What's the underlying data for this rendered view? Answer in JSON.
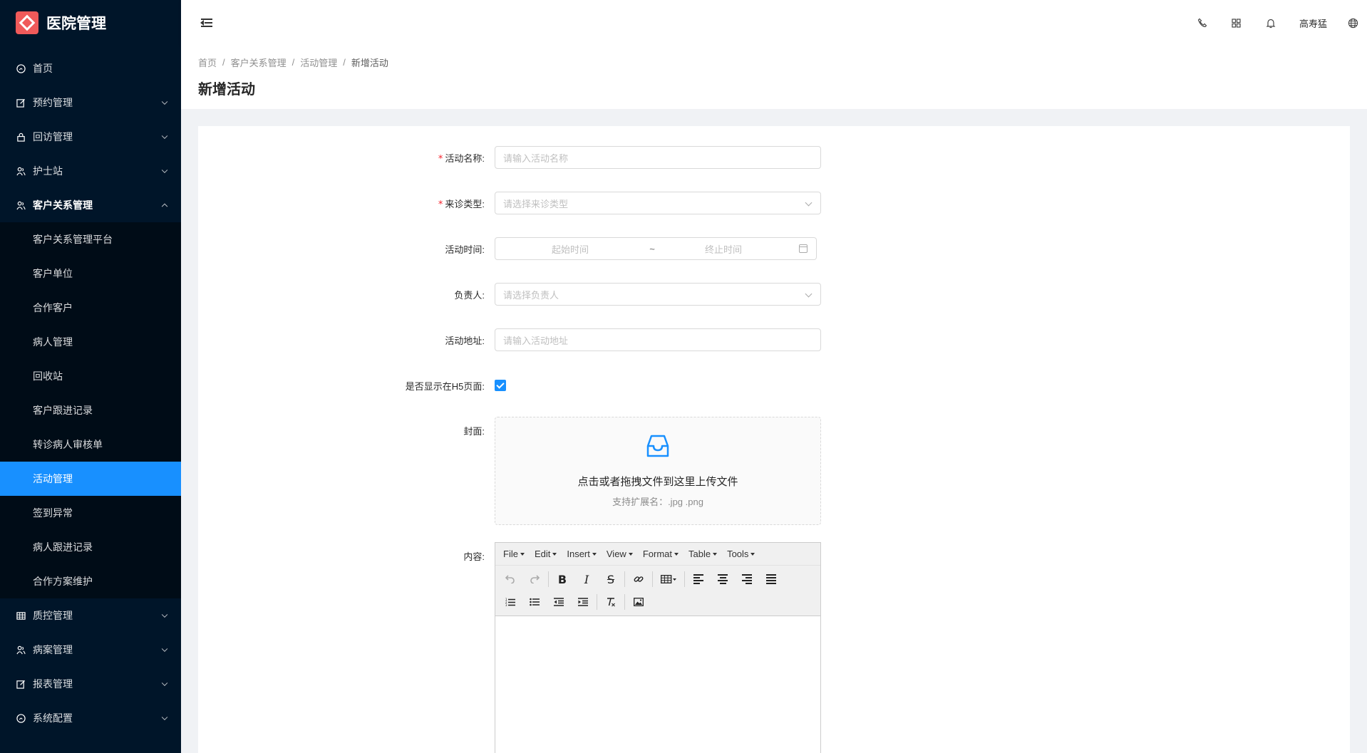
{
  "app": {
    "title": "医院管理"
  },
  "sidebar": {
    "items": [
      {
        "label": "首页",
        "icon": "dashboard-icon"
      },
      {
        "label": "预约管理",
        "icon": "edit-icon"
      },
      {
        "label": "回访管理",
        "icon": "lock-icon"
      },
      {
        "label": "护士站",
        "icon": "users-icon"
      },
      {
        "label": "客户关系管理",
        "icon": "users-icon"
      },
      {
        "label": "质控管理",
        "icon": "table-icon"
      },
      {
        "label": "病案管理",
        "icon": "users-icon"
      },
      {
        "label": "报表管理",
        "icon": "edit-icon"
      },
      {
        "label": "系统配置",
        "icon": "dashboard-icon"
      }
    ],
    "submenu": [
      "客户关系管理平台",
      "客户单位",
      "合作客户",
      "病人管理",
      "回收站",
      "客户跟进记录",
      "转诊病人审核单",
      "活动管理",
      "签到异常",
      "病人跟进记录",
      "合作方案维护"
    ]
  },
  "header": {
    "user_name": "高寿猛",
    "icons": [
      "phone-icon",
      "apps-icon",
      "bell-icon",
      "globe-icon"
    ]
  },
  "breadcrumb": [
    "首页",
    "客户关系管理",
    "活动管理",
    "新增活动"
  ],
  "page": {
    "title": "新增活动"
  },
  "form": {
    "activity_name": {
      "label": "活动名称:",
      "placeholder": "请输入活动名称"
    },
    "visit_type": {
      "label": "来诊类型:",
      "placeholder": "请选择来诊类型"
    },
    "activity_time": {
      "label": "活动时间:",
      "start_placeholder": "起始时间",
      "separator": "~",
      "end_placeholder": "终止时间"
    },
    "owner": {
      "label": "负责人:",
      "placeholder": "请选择负责人"
    },
    "address": {
      "label": "活动地址:",
      "placeholder": "请输入活动地址"
    },
    "show_h5": {
      "label": "是否显示在H5页面:",
      "checked": true
    },
    "cover": {
      "label": "封面:",
      "upload_text": "点击或者拖拽文件到这里上传文件",
      "upload_hint": "支持扩展名：.jpg .png"
    },
    "content": {
      "label": "内容:"
    }
  },
  "editor": {
    "menus": [
      "File",
      "Edit",
      "Insert",
      "View",
      "Format",
      "Table",
      "Tools"
    ]
  },
  "colors": {
    "sidebar_bg": "#001529",
    "submenu_bg": "#000c17",
    "accent": "#1890ff",
    "required": "#f5222d",
    "logo": "#f05a5a"
  }
}
